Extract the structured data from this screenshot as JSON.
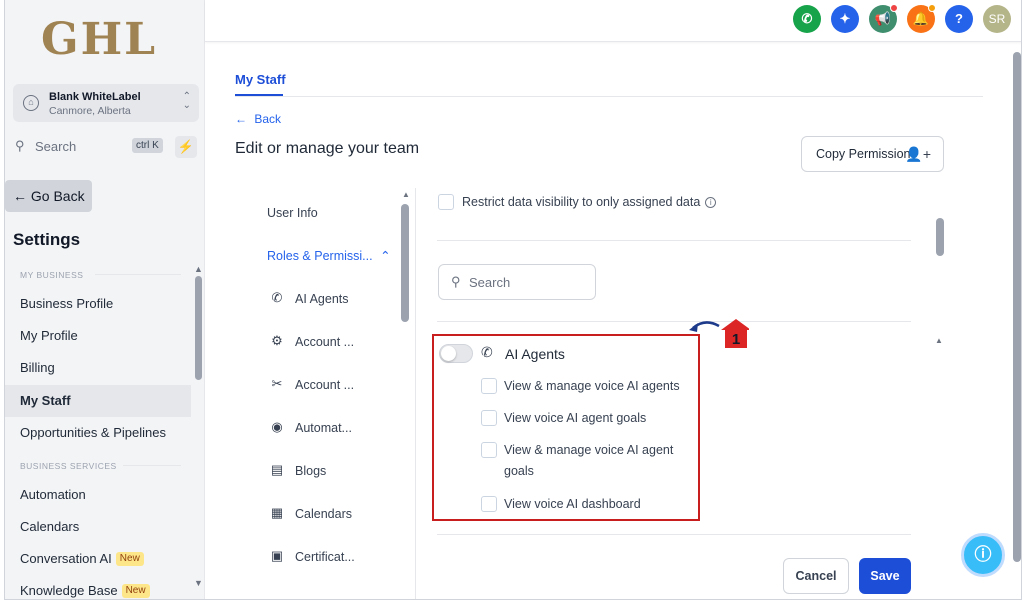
{
  "logo": "GHL",
  "location": {
    "name": "Blank WhiteLabel",
    "sub": "Canmore, Alberta"
  },
  "sidebar": {
    "search_label": "Search",
    "search_shortcut": "ctrl K",
    "go_back": "← Go Back",
    "title": "Settings",
    "section_my_business": "MY BUSINESS",
    "section_business_services": "BUSINESS SERVICES",
    "items": [
      {
        "label": "Business Profile"
      },
      {
        "label": "My Profile"
      },
      {
        "label": "Billing"
      },
      {
        "label": "My Staff"
      },
      {
        "label": "Opportunities & Pipelines"
      },
      {
        "label": "Automation"
      },
      {
        "label": "Calendars"
      },
      {
        "label": "Conversation AI",
        "badge": "New"
      },
      {
        "label": "Knowledge Base",
        "badge": "New"
      }
    ]
  },
  "topbar": {
    "avatar_initials": "SR",
    "help": "?"
  },
  "main": {
    "tab": "My Staff",
    "back": "Back",
    "title": "Edit or manage your team",
    "copy_permission": "Copy Permission"
  },
  "perm_nav": {
    "user_info": "User Info",
    "roles": "Roles & Permissi...",
    "items": [
      {
        "label": "AI Agents",
        "icon": "phone-ai-icon"
      },
      {
        "label": "Account ...",
        "icon": "account-icon"
      },
      {
        "label": "Account ...",
        "icon": "tools-icon"
      },
      {
        "label": "Automat...",
        "icon": "play-icon"
      },
      {
        "label": "Blogs",
        "icon": "document-icon"
      },
      {
        "label": "Calendars",
        "icon": "calendar-icon"
      },
      {
        "label": "Certificat...",
        "icon": "certificate-icon"
      }
    ]
  },
  "permissions": {
    "restrict": "Restrict data visibility to only assigned data",
    "search_placeholder": "Search",
    "group": "AI Agents",
    "items": [
      {
        "label": "View & manage voice AI agents"
      },
      {
        "label": "View voice AI agent goals"
      },
      {
        "label": "View & manage voice AI agent goals"
      },
      {
        "label": "View voice AI dashboard"
      }
    ],
    "marker_number": "1"
  },
  "actions": {
    "cancel": "Cancel",
    "save": "Save"
  },
  "colors": {
    "primary": "#1d4ed8",
    "highlight": "#c81e1e",
    "logo": "#a08352"
  }
}
